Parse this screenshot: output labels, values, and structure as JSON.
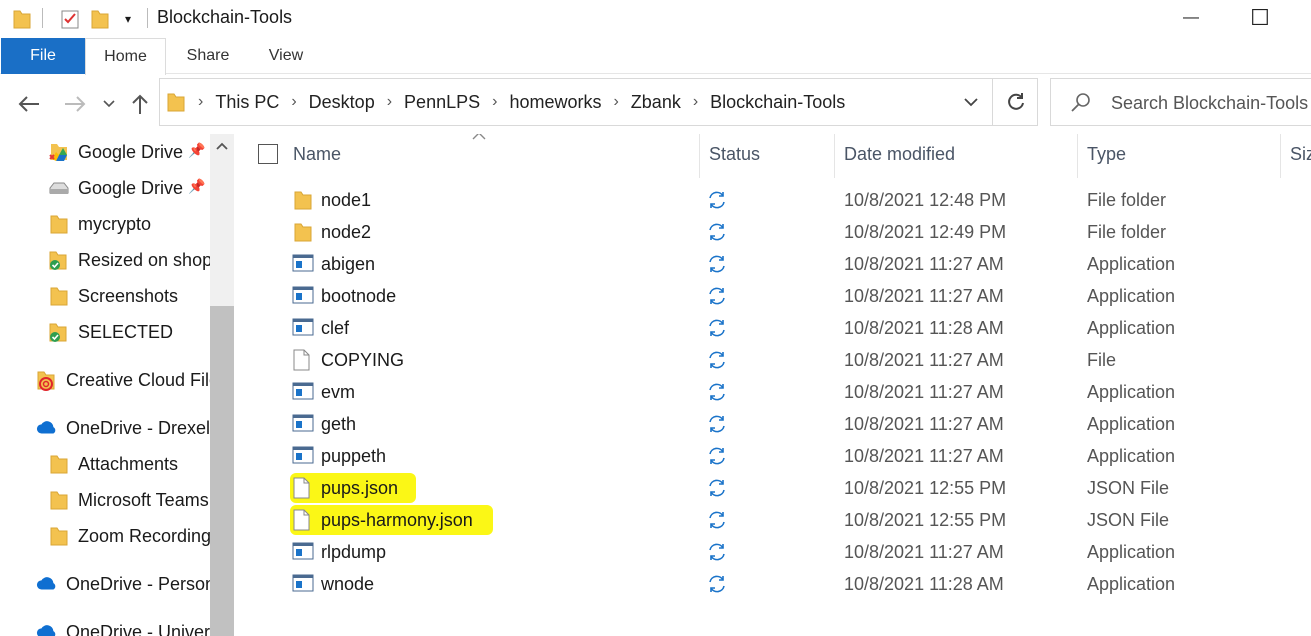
{
  "window": {
    "title": "Blockchain-Tools",
    "minimize_glyph": "—",
    "maximize_glyph": "☐"
  },
  "ribbon": {
    "tabs": [
      {
        "label": "File"
      },
      {
        "label": "Home"
      },
      {
        "label": "Share"
      },
      {
        "label": "View"
      }
    ]
  },
  "address": {
    "crumbs": [
      "This PC",
      "Desktop",
      "PennLPS",
      "homeworks",
      "Zbank",
      "Blockchain-Tools"
    ],
    "separator": "›"
  },
  "search": {
    "placeholder": "Search Blockchain-Tools"
  },
  "nav": {
    "items": [
      {
        "label": "Google Drive",
        "icon": "google-drive-icon",
        "pinned": true
      },
      {
        "label": "Google Drive",
        "icon": "drive-disk-icon",
        "pinned": true
      },
      {
        "label": "mycrypto",
        "icon": "folder-icon"
      },
      {
        "label": "Resized on shop",
        "icon": "folder-synced-icon"
      },
      {
        "label": "Screenshots",
        "icon": "folder-icon"
      },
      {
        "label": "SELECTED",
        "icon": "folder-synced-icon"
      },
      {
        "label": "Creative Cloud Files",
        "icon": "creative-cloud-icon"
      },
      {
        "label": "OneDrive - Drexel",
        "icon": "onedrive-icon"
      },
      {
        "label": "Attachments",
        "icon": "folder-icon"
      },
      {
        "label": "Microsoft Teams",
        "icon": "folder-icon"
      },
      {
        "label": "Zoom Recordings",
        "icon": "folder-icon"
      },
      {
        "label": "OneDrive - Personal",
        "icon": "onedrive-icon"
      },
      {
        "label": "OneDrive - Univers",
        "icon": "onedrive-icon"
      }
    ]
  },
  "columns": {
    "name": "Name",
    "status": "Status",
    "date": "Date modified",
    "type": "Type",
    "size": "Siz"
  },
  "files": [
    {
      "name": "node1",
      "icon": "folder-icon",
      "date": "10/8/2021 12:48 PM",
      "type": "File folder",
      "highlighted": false
    },
    {
      "name": "node2",
      "icon": "folder-icon",
      "date": "10/8/2021 12:49 PM",
      "type": "File folder",
      "highlighted": false
    },
    {
      "name": "abigen",
      "icon": "application-icon",
      "date": "10/8/2021 11:27 AM",
      "type": "Application",
      "highlighted": false
    },
    {
      "name": "bootnode",
      "icon": "application-icon",
      "date": "10/8/2021 11:27 AM",
      "type": "Application",
      "highlighted": false
    },
    {
      "name": "clef",
      "icon": "application-icon",
      "date": "10/8/2021 11:28 AM",
      "type": "Application",
      "highlighted": false
    },
    {
      "name": "COPYING",
      "icon": "file-icon",
      "date": "10/8/2021 11:27 AM",
      "type": "File",
      "highlighted": false
    },
    {
      "name": "evm",
      "icon": "application-icon",
      "date": "10/8/2021 11:27 AM",
      "type": "Application",
      "highlighted": false
    },
    {
      "name": "geth",
      "icon": "application-icon",
      "date": "10/8/2021 11:27 AM",
      "type": "Application",
      "highlighted": false
    },
    {
      "name": "puppeth",
      "icon": "application-icon",
      "date": "10/8/2021 11:27 AM",
      "type": "Application",
      "highlighted": false
    },
    {
      "name": "pups.json",
      "icon": "file-icon",
      "date": "10/8/2021 12:55 PM",
      "type": "JSON File",
      "highlighted": true
    },
    {
      "name": "pups-harmony.json",
      "icon": "file-icon",
      "date": "10/8/2021 12:55 PM",
      "type": "JSON File",
      "highlighted": true
    },
    {
      "name": "rlpdump",
      "icon": "application-icon",
      "date": "10/8/2021 11:27 AM",
      "type": "Application",
      "highlighted": false
    },
    {
      "name": "wnode",
      "icon": "application-icon",
      "date": "10/8/2021 11:28 AM",
      "type": "Application",
      "highlighted": false
    }
  ],
  "colors": {
    "file_tab": "#1a6fc6",
    "highlight": "#fbf716",
    "folder": "#f3c24f",
    "sync": "#1a73c9"
  }
}
